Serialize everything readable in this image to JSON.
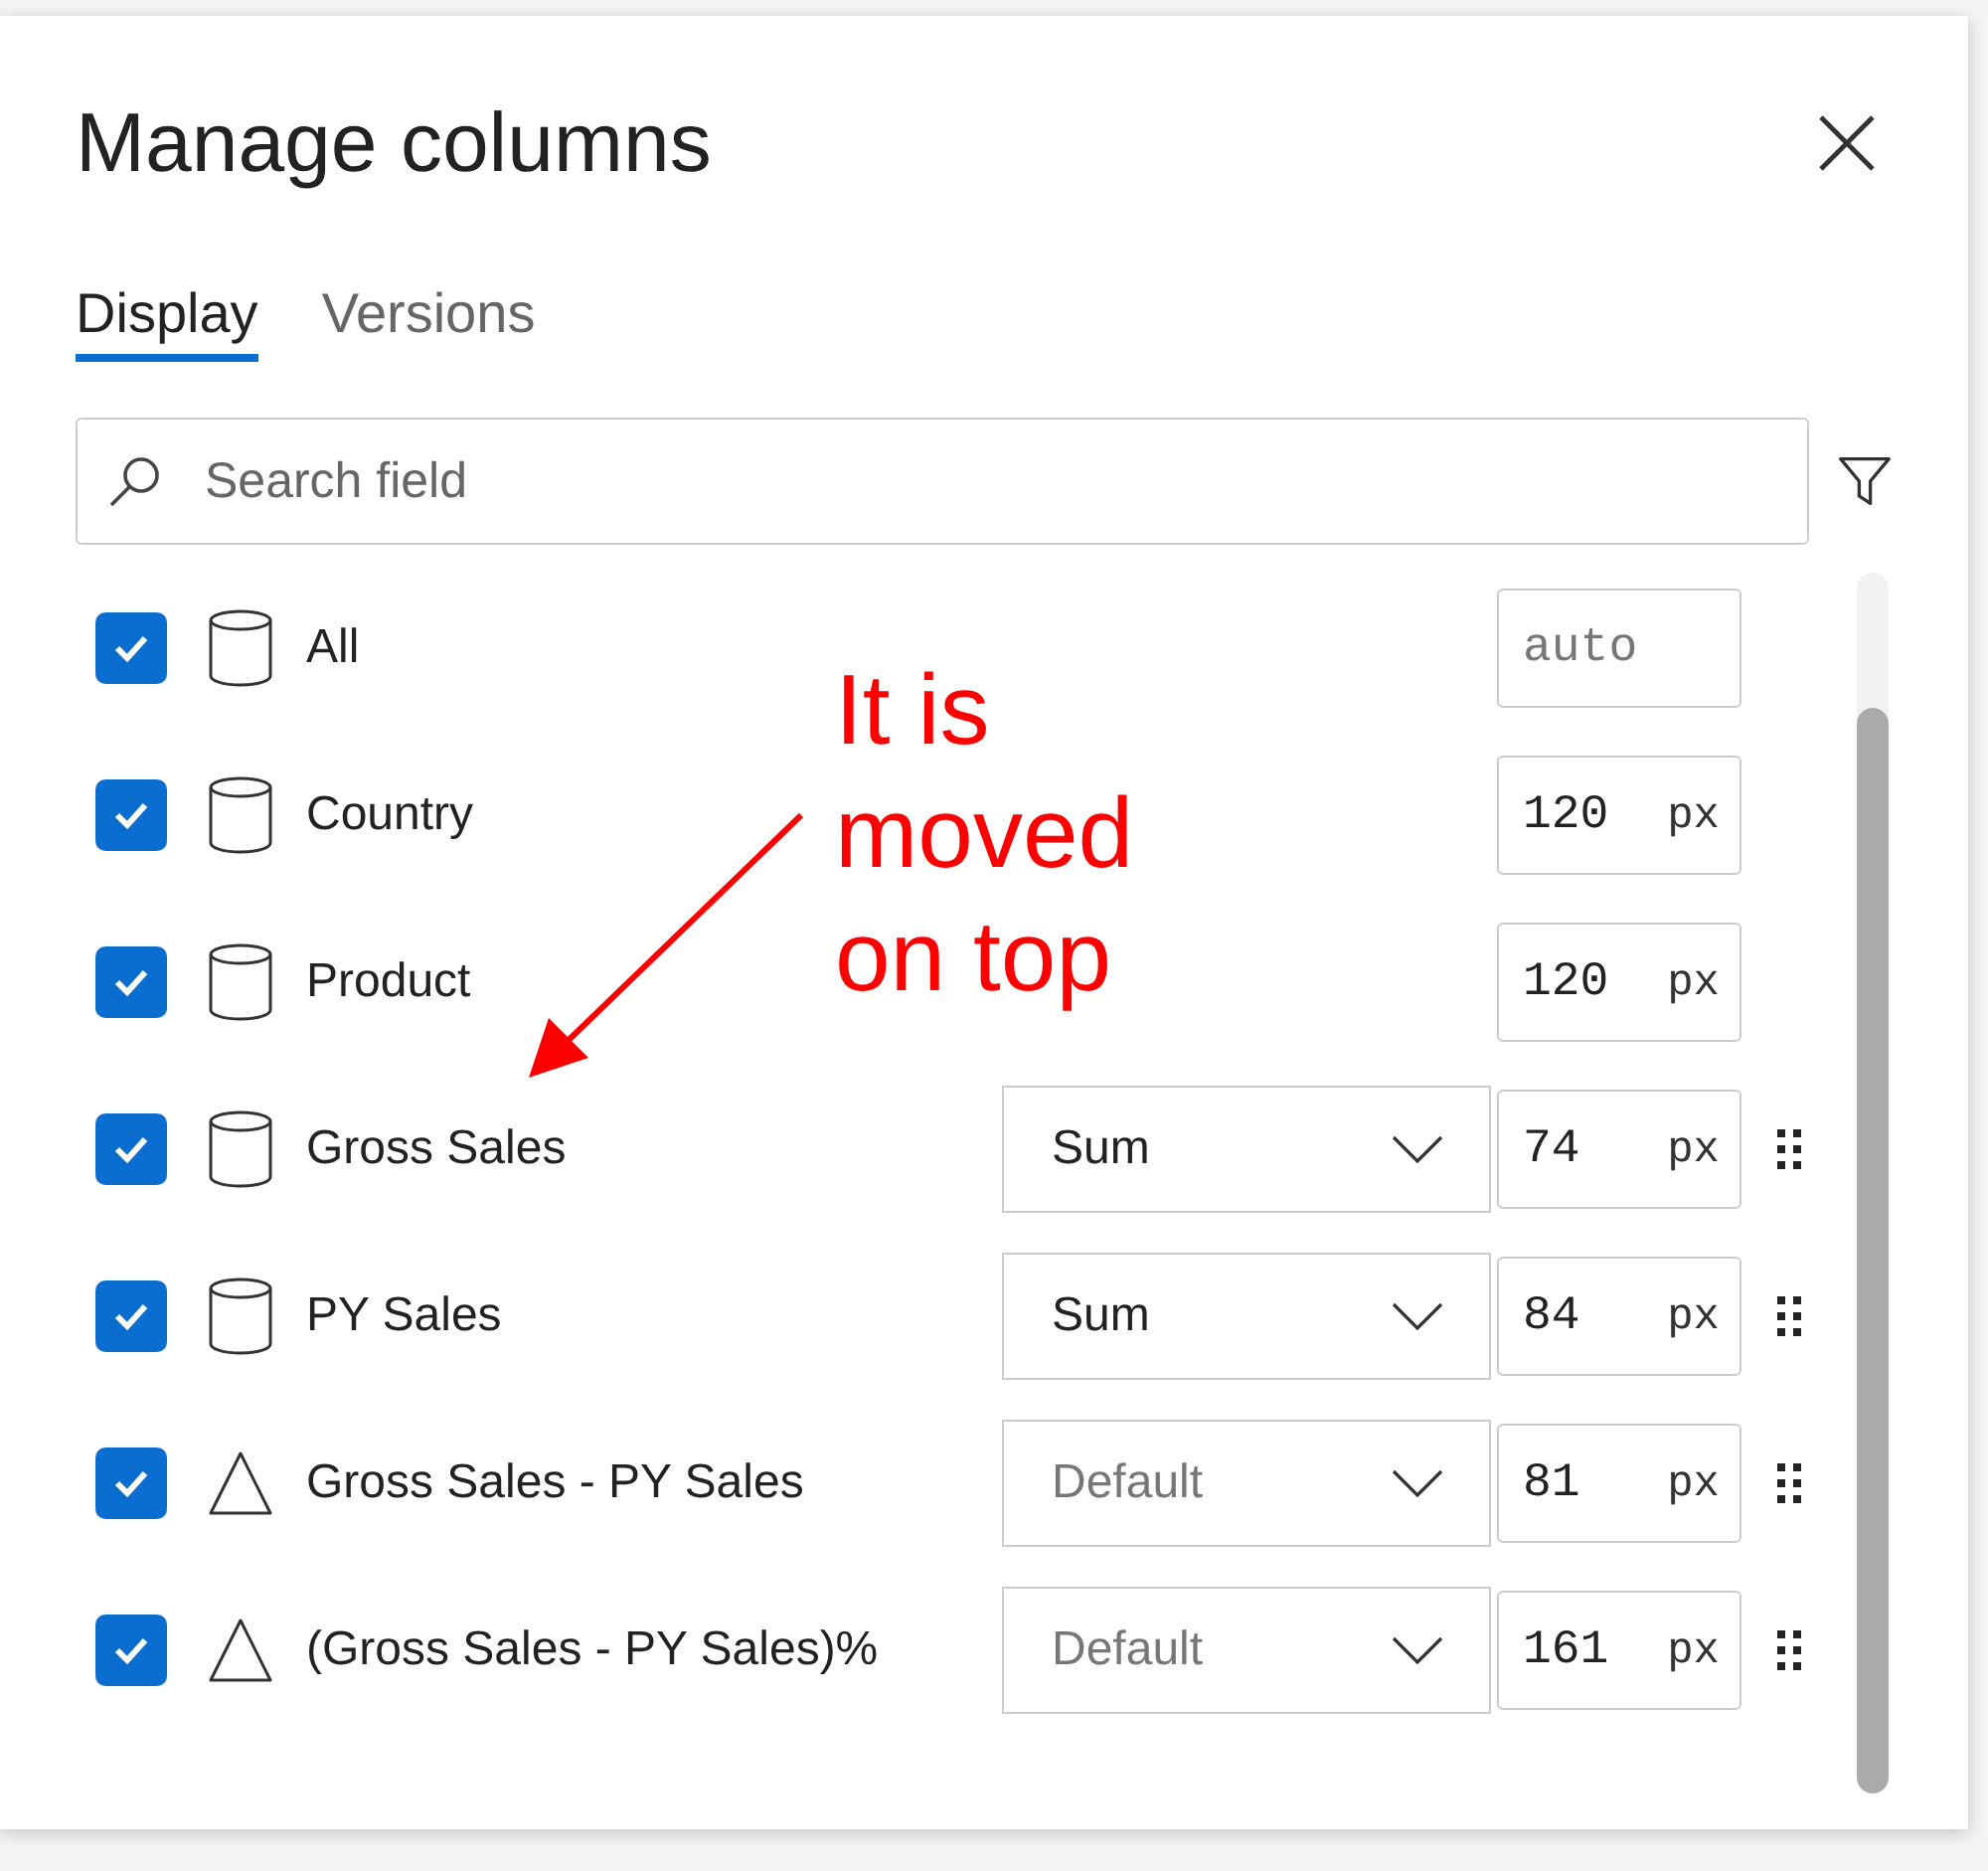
{
  "dialog": {
    "title": "Manage columns"
  },
  "tabs": [
    {
      "label": "Display",
      "selected": true
    },
    {
      "label": "Versions",
      "selected": false
    }
  ],
  "search": {
    "placeholder": "Search field"
  },
  "columns": [
    {
      "name": "All",
      "kind": "dimension",
      "checked": true,
      "width": {
        "placeholder": "auto"
      },
      "draggable": false
    },
    {
      "name": "Country",
      "kind": "dimension",
      "checked": true,
      "width": {
        "value": "120",
        "unit": "px"
      },
      "draggable": false
    },
    {
      "name": "Product",
      "kind": "dimension",
      "checked": true,
      "width": {
        "value": "120",
        "unit": "px"
      },
      "draggable": false
    },
    {
      "name": "Gross Sales",
      "kind": "dimension",
      "checked": true,
      "aggregation": {
        "text": "Sum",
        "placeholder": false
      },
      "width": {
        "value": "74",
        "unit": "px"
      },
      "draggable": true
    },
    {
      "name": "PY Sales",
      "kind": "dimension",
      "checked": true,
      "aggregation": {
        "text": "Sum",
        "placeholder": false
      },
      "width": {
        "value": "84",
        "unit": "px"
      },
      "draggable": true
    },
    {
      "name": "Gross Sales - PY Sales",
      "kind": "calculated",
      "checked": true,
      "aggregation": {
        "text": "Default",
        "placeholder": true
      },
      "width": {
        "value": "81",
        "unit": "px"
      },
      "draggable": true
    },
    {
      "name": "(Gross Sales - PY Sales)%",
      "kind": "calculated",
      "checked": true,
      "aggregation": {
        "text": "Default",
        "placeholder": true
      },
      "width": {
        "value": "161",
        "unit": "px"
      },
      "draggable": true
    }
  ],
  "annotation": {
    "text": "It is moved on top"
  }
}
